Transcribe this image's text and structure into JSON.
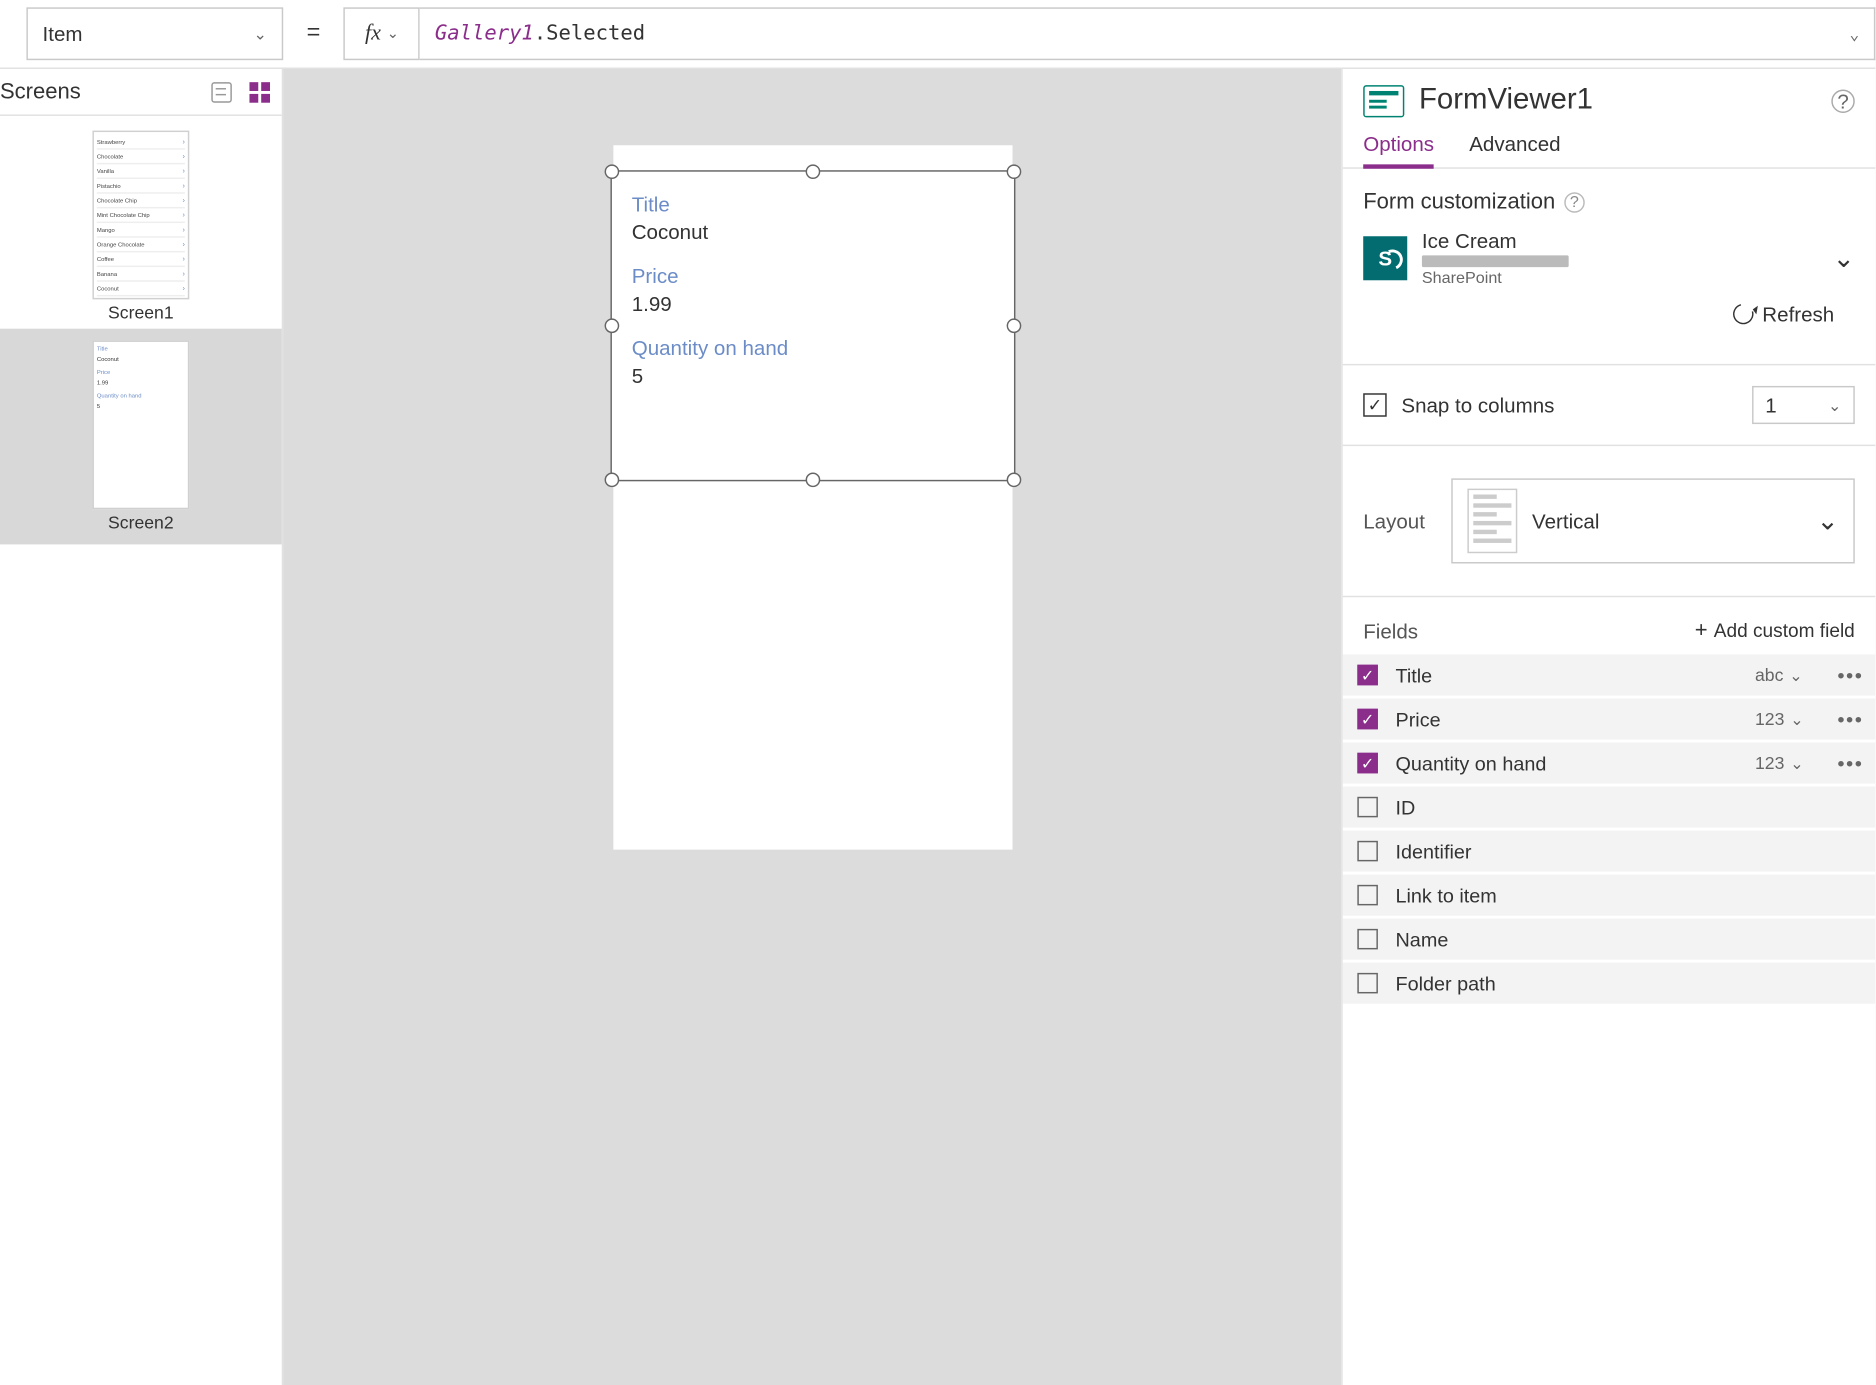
{
  "topbar": {
    "property": "Item",
    "fx": "fx",
    "formula_obj": "Gallery1",
    "formula_rest": ".Selected"
  },
  "left": {
    "title": "Screens",
    "screen1": {
      "label": "Screen1",
      "rows": [
        "Strawberry",
        "Chocolate",
        "Vanilla",
        "Pistachio",
        "Chocolate Chip",
        "Mint Chocolate Chip",
        "Mango",
        "Orange Chocolate",
        "Coffee",
        "Banana",
        "Coconut"
      ]
    },
    "screen2": {
      "label": "Screen2",
      "mini": {
        "l1": "Title",
        "v1": "Coconut",
        "l2": "Price",
        "v2": "1.99",
        "l3": "Quantity on hand",
        "v3": "5"
      }
    }
  },
  "canvas": {
    "fields": [
      {
        "label": "Title",
        "value": "Coconut"
      },
      {
        "label": "Price",
        "value": "1.99"
      },
      {
        "label": "Quantity on hand",
        "value": "5"
      }
    ]
  },
  "right": {
    "control_name": "FormViewer1",
    "tabs": {
      "options": "Options",
      "advanced": "Advanced"
    },
    "form_customization": "Form customization",
    "data_source": {
      "title": "Ice Cream",
      "provider": "SharePoint"
    },
    "refresh": "Refresh",
    "snap": {
      "label": "Snap to columns",
      "value": "1"
    },
    "layout": {
      "label": "Layout",
      "value": "Vertical"
    },
    "fields_label": "Fields",
    "add_custom": "Add custom field",
    "fields": [
      {
        "on": true,
        "name": "Title",
        "type": "abc"
      },
      {
        "on": true,
        "name": "Price",
        "type": "123"
      },
      {
        "on": true,
        "name": "Quantity on hand",
        "type": "123"
      },
      {
        "on": false,
        "name": "ID"
      },
      {
        "on": false,
        "name": "Identifier"
      },
      {
        "on": false,
        "name": "Link to item"
      },
      {
        "on": false,
        "name": "Name"
      },
      {
        "on": false,
        "name": "Folder path"
      }
    ]
  }
}
